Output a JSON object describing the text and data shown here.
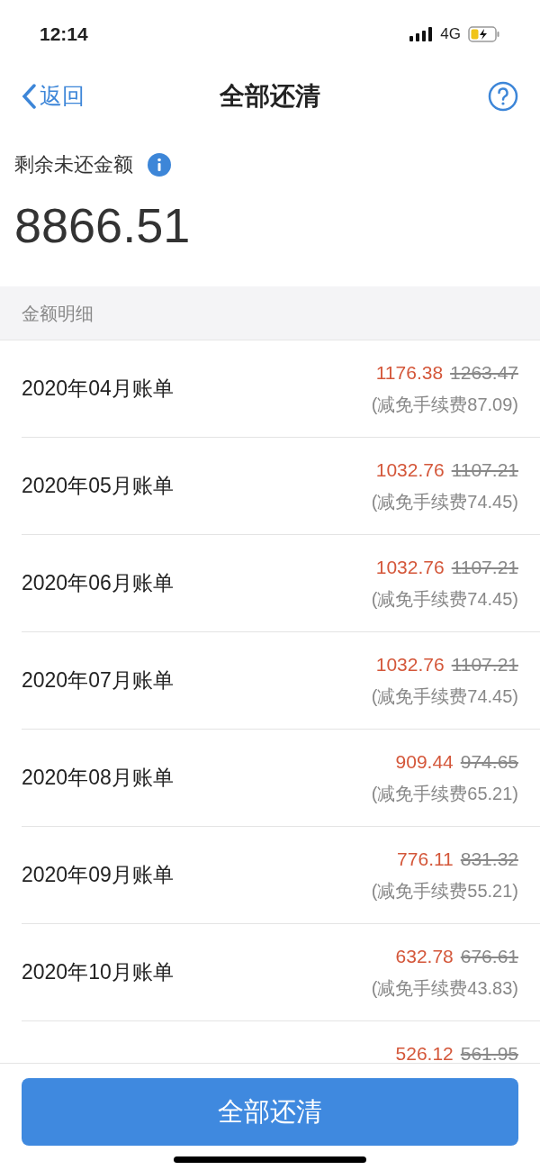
{
  "status_bar": {
    "time": "12:14",
    "network": "4G"
  },
  "nav": {
    "back": "返回",
    "title": "全部还清"
  },
  "summary": {
    "label": "剩余未还金额",
    "amount": "8866.51"
  },
  "section": {
    "title": "金额明细"
  },
  "bills": [
    {
      "label": "2020年04月账单",
      "amount": "1176.38",
      "original": "1263.47",
      "note": "(减免手续费87.09)"
    },
    {
      "label": "2020年05月账单",
      "amount": "1032.76",
      "original": "1107.21",
      "note": "(减免手续费74.45)"
    },
    {
      "label": "2020年06月账单",
      "amount": "1032.76",
      "original": "1107.21",
      "note": "(减免手续费74.45)"
    },
    {
      "label": "2020年07月账单",
      "amount": "1032.76",
      "original": "1107.21",
      "note": "(减免手续费74.45)"
    },
    {
      "label": "2020年08月账单",
      "amount": "909.44",
      "original": "974.65",
      "note": "(减免手续费65.21)"
    },
    {
      "label": "2020年09月账单",
      "amount": "776.11",
      "original": "831.32",
      "note": "(减免手续费55.21)"
    },
    {
      "label": "2020年10月账单",
      "amount": "632.78",
      "original": "676.61",
      "note": "(减免手续费43.83)"
    },
    {
      "amount": "526.12",
      "original": "561.95"
    }
  ],
  "button": "全部还清"
}
